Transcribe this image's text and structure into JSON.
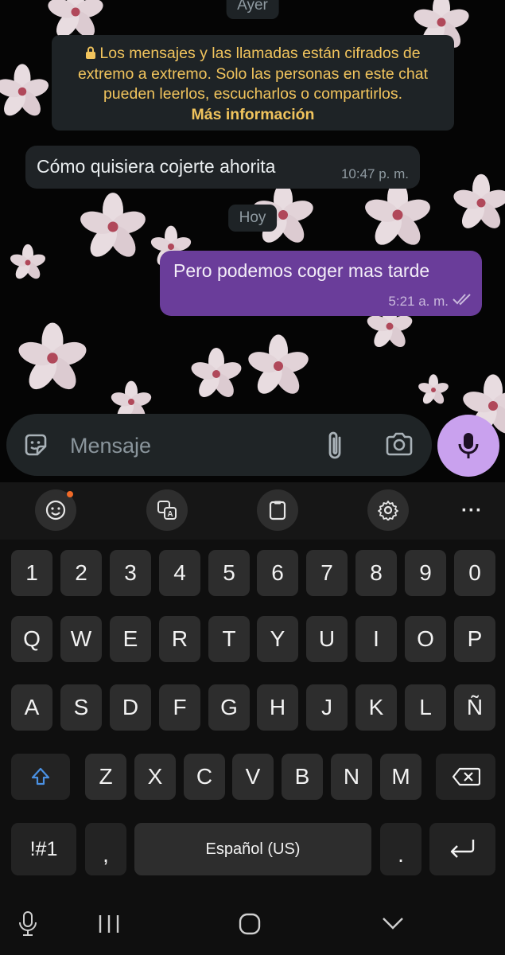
{
  "chat": {
    "day_yesterday": "Ayer",
    "encryption_notice": "Los mensajes y las llamadas están cifrados de extremo a extremo. Solo las personas en este chat pueden leerlos, escucharlos o compartirlos.",
    "encryption_more": "Más información",
    "messages_yesterday": [
      {
        "direction": "incoming",
        "text": "Cómo quisiera cojerte ahorita",
        "time": "10:47 p. m."
      }
    ],
    "day_today": "Hoy",
    "messages_today": [
      {
        "direction": "outgoing",
        "text": "Pero podemos coger mas tarde",
        "time": "5:21 a. m.",
        "status": "read-double-check"
      }
    ]
  },
  "composer": {
    "placeholder": "Mensaje",
    "value": "",
    "icons": [
      "sticker-icon",
      "attach-icon",
      "camera-icon",
      "microphone-icon"
    ]
  },
  "keyboard": {
    "toolbar_icons": [
      "emoji-icon",
      "translate-icon",
      "clipboard-icon",
      "settings-icon",
      "more-icon"
    ],
    "number_row": [
      "1",
      "2",
      "3",
      "4",
      "5",
      "6",
      "7",
      "8",
      "9",
      "0"
    ],
    "row1": [
      "Q",
      "W",
      "E",
      "R",
      "T",
      "Y",
      "U",
      "I",
      "O",
      "P"
    ],
    "row2": [
      "A",
      "S",
      "D",
      "F",
      "G",
      "H",
      "J",
      "K",
      "L",
      "Ñ"
    ],
    "row3": [
      "Z",
      "X",
      "C",
      "V",
      "B",
      "N",
      "M"
    ],
    "symbols_key": "!#1",
    "comma_key": ",",
    "space_label": "Español (US)",
    "period_key": ".",
    "language_indicator_colors": {
      "shift": "#4a90e2",
      "notification_dot": "#f06a28"
    }
  },
  "navbar": {
    "icons": [
      "voice-input-icon",
      "recent-apps-icon",
      "home-icon",
      "hide-keyboard-icon"
    ]
  },
  "colors": {
    "outgoing_bubble": "#6a3d9a",
    "incoming_bubble": "#1f2326",
    "notice_text": "#f1c45d",
    "mic_button": "#c9a1ee"
  }
}
